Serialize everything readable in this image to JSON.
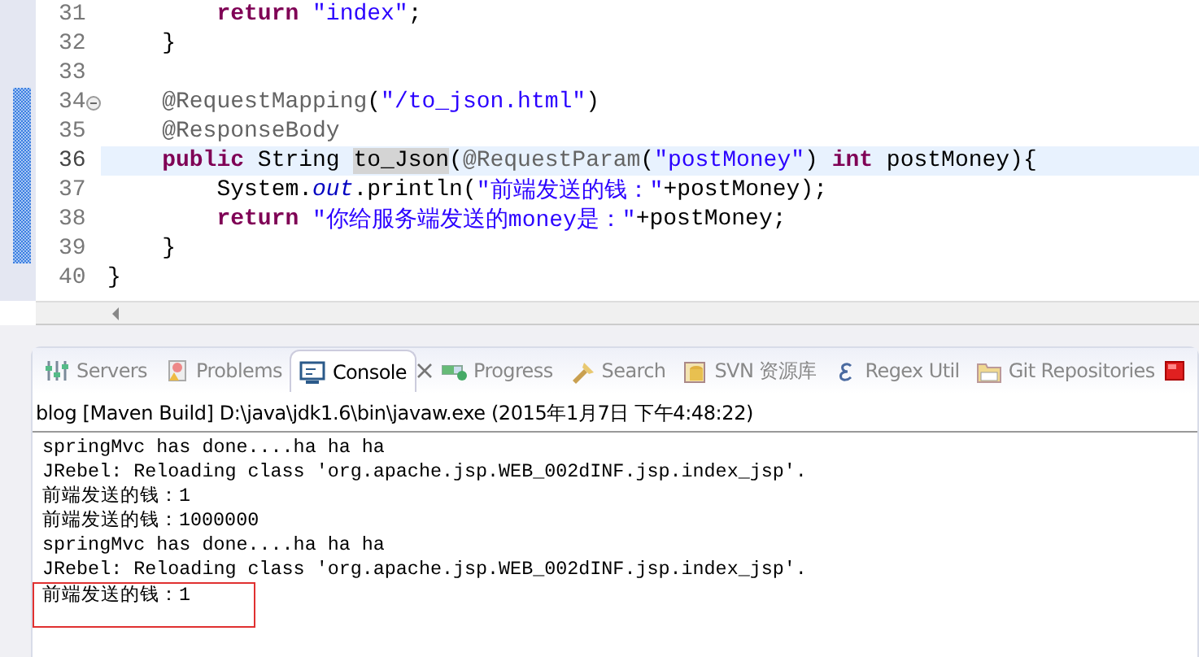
{
  "editor": {
    "lines": [
      {
        "number": "31",
        "changed": false,
        "foldable": false,
        "current": false,
        "tokens": [
          {
            "kind": "keyword",
            "text": "        return"
          },
          {
            "kind": "string",
            "text": " \"index\""
          },
          {
            "kind": "plain",
            "text": ";"
          }
        ]
      },
      {
        "number": "32",
        "changed": false,
        "foldable": false,
        "current": false,
        "tokens": [
          {
            "kind": "plain",
            "text": "    }"
          }
        ]
      },
      {
        "number": "33",
        "changed": false,
        "foldable": false,
        "current": false
      },
      {
        "number": "34",
        "changed": true,
        "foldable": true,
        "current": false,
        "tokens": [
          {
            "kind": "annotation",
            "text": "    @RequestMapping"
          },
          {
            "kind": "plain",
            "text": "("
          },
          {
            "kind": "string",
            "text": "\"/to_json.html\""
          },
          {
            "kind": "plain",
            "text": ")"
          }
        ]
      },
      {
        "number": "35",
        "changed": true,
        "foldable": false,
        "current": false,
        "tokens": [
          {
            "kind": "annotation",
            "text": "    @ResponseBody"
          }
        ]
      },
      {
        "number": "36",
        "changed": true,
        "foldable": false,
        "current": true,
        "tokens": [
          {
            "kind": "keyword",
            "text": "    public"
          },
          {
            "kind": "plain",
            "text": " String "
          },
          {
            "kind": "occurrence",
            "text": "to_Json"
          },
          {
            "kind": "plain",
            "text": "("
          },
          {
            "kind": "annotation",
            "text": "@RequestParam"
          },
          {
            "kind": "plain",
            "text": "("
          },
          {
            "kind": "string",
            "text": "\"postMoney\""
          },
          {
            "kind": "plain",
            "text": ") "
          },
          {
            "kind": "keyword",
            "text": "int"
          },
          {
            "kind": "plain",
            "text": " postMoney){"
          }
        ]
      },
      {
        "number": "37",
        "changed": true,
        "foldable": false,
        "current": false,
        "tokens": [
          {
            "kind": "plain",
            "text": "        System."
          },
          {
            "kind": "static",
            "text": "out"
          },
          {
            "kind": "plain",
            "text": ".println("
          },
          {
            "kind": "string",
            "text": "\"前端发送的钱：\""
          },
          {
            "kind": "plain",
            "text": "+postMoney);"
          }
        ]
      },
      {
        "number": "38",
        "changed": true,
        "foldable": false,
        "current": false,
        "tokens": [
          {
            "kind": "keyword",
            "text": "        return"
          },
          {
            "kind": "string",
            "text": " \"你给服务端发送的money是：\""
          },
          {
            "kind": "plain",
            "text": "+postMoney;"
          }
        ]
      },
      {
        "number": "39",
        "changed": true,
        "foldable": false,
        "current": false,
        "tokens": [
          {
            "kind": "plain",
            "text": "    }"
          }
        ]
      },
      {
        "number": "40",
        "changed": false,
        "foldable": false,
        "current": false,
        "tokens": [
          {
            "kind": "plain",
            "text": "}"
          }
        ]
      }
    ]
  },
  "views": {
    "tabs": [
      {
        "kind": "servers",
        "label": "Servers",
        "selected": false
      },
      {
        "kind": "problems",
        "label": "Problems",
        "selected": false
      },
      {
        "kind": "console",
        "label": "Console",
        "selected": true
      },
      {
        "kind": "progress",
        "label": "Progress",
        "selected": false
      },
      {
        "kind": "search",
        "label": "Search",
        "selected": false
      },
      {
        "kind": "svn",
        "label": "SVN 资源库",
        "selected": false
      },
      {
        "kind": "regex",
        "label": "Regex Util",
        "selected": false
      },
      {
        "kind": "git",
        "label": "Git Repositories",
        "selected": false
      }
    ],
    "console": {
      "title": "blog [Maven Build] D:\\java\\jdk1.6\\bin\\javaw.exe (2015年1月7日 下午4:48:22)",
      "lines": [
        {
          "text": "springMvc has done....ha ha ha",
          "boxed": false
        },
        {
          "text": "JRebel: Reloading class 'org.apache.jsp.WEB_002dINF.jsp.index_jsp'.",
          "boxed": false
        },
        {
          "text": "前端发送的钱：1",
          "boxed": false
        },
        {
          "text": "前端发送的钱：1000000",
          "boxed": false
        },
        {
          "text": "springMvc has done....ha ha ha",
          "boxed": false
        },
        {
          "text": "JRebel: Reloading class 'org.apache.jsp.WEB_002dINF.jsp.index_jsp'.",
          "boxed": false
        },
        {
          "text": "前端发送的钱：1",
          "boxed": true
        }
      ]
    }
  }
}
